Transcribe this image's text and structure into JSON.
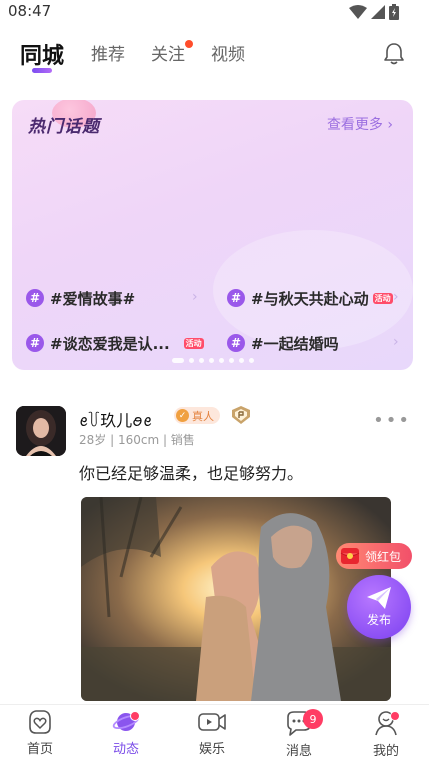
{
  "status_bar": {
    "time": "08:47"
  },
  "top_tabs": [
    {
      "label": "同城",
      "active": true
    },
    {
      "label": "推荐",
      "active": false
    },
    {
      "label": "关注",
      "active": false,
      "has_dot": true
    },
    {
      "label": "视频",
      "active": false
    }
  ],
  "topics": {
    "title": "热门话题",
    "more_label": "查看更多",
    "items": [
      {
        "label": "#爱情故事#",
        "hot": false
      },
      {
        "label": "#与秋天共赴心动",
        "hot": true
      },
      {
        "label": "#谈恋爱我是认...",
        "hot": true
      },
      {
        "label": "#一起结婚吗",
        "hot": false
      }
    ],
    "hot_badge": "活动",
    "page_count": 8,
    "active_page": 0
  },
  "post": {
    "username": "ꫀ꒦玖儿ꪮꫀ",
    "verified_label": "真人",
    "meta": "28岁 | 160cm | 销售",
    "text": "你已经足够温柔，也足够努力。"
  },
  "floating": {
    "redpack_label": "领红包",
    "publish_label": "发布"
  },
  "bottom_nav": [
    {
      "label": "首页",
      "icon": "home-heart-icon",
      "active": false
    },
    {
      "label": "动态",
      "icon": "planet-icon",
      "active": true,
      "dot": true
    },
    {
      "label": "娱乐",
      "icon": "video-icon",
      "active": false
    },
    {
      "label": "消息",
      "icon": "chat-icon",
      "active": false,
      "badge": "9"
    },
    {
      "label": "我的",
      "icon": "profile-icon",
      "active": false,
      "dot": true
    }
  ],
  "colors": {
    "accent": "#7a4ce8",
    "badge_red": "#ff3c64"
  }
}
